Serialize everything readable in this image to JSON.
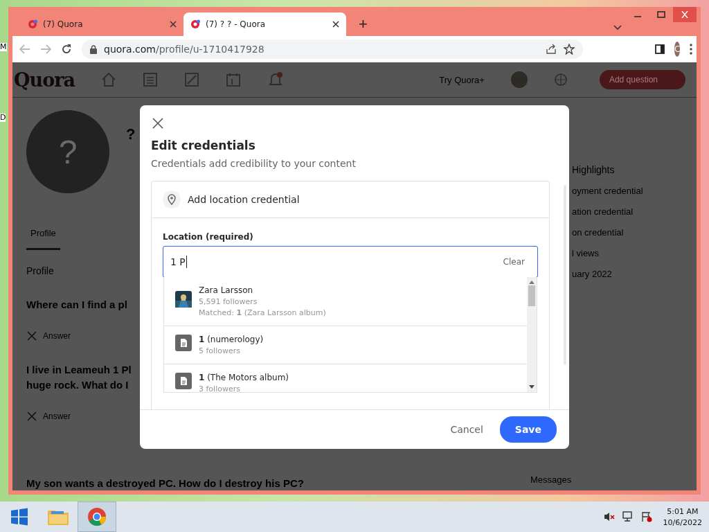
{
  "desktop": {
    "edge_labels": [
      "M",
      "D"
    ]
  },
  "browser": {
    "tabs": [
      {
        "title": "(7) Quora",
        "selected": false
      },
      {
        "title": "(7) ? ? - Quora",
        "selected": true
      }
    ],
    "new_tab": "+",
    "url_host": "quora.com",
    "url_path": "/profile/u-1710417928",
    "profile_initial": "C"
  },
  "page": {
    "logo": "Quora",
    "try_plus": "Try Quora+",
    "add_question": "Add question",
    "avatar": "?",
    "name": "?",
    "profile_tab": "Profile",
    "section": "Profile",
    "questions": [
      {
        "title": "Where can I find a pl",
        "action": "Answer"
      },
      {
        "title": "I live in Leameuh 1 Pl",
        "title_continued": "huge rock. What do I",
        "action": "Answer"
      },
      {
        "title": "My son wants a destroyed PC. How do I destroy his PC?"
      }
    ],
    "highlights_title": "Highlights",
    "highlights": [
      "oyment credential",
      "ation credential",
      "on credential",
      "l views",
      "uary 2022"
    ],
    "messages": "Messages"
  },
  "dialog": {
    "title": "Edit credentials",
    "subtitle": "Credentials add credibility to your content",
    "section": "Add location credential",
    "field_label": "Location (required)",
    "value": "1 P",
    "clear": "Clear",
    "results": [
      {
        "kind": "person",
        "title": "Zara Larsson",
        "followers": "5,591 followers",
        "matched": "Matched: **1** (Zara Larsson album)"
      },
      {
        "kind": "topic",
        "title": "**1** (numerology)",
        "followers": "5 followers"
      },
      {
        "kind": "topic",
        "title": "**1** (The Motors album)",
        "followers": "3 followers"
      }
    ],
    "cancel": "Cancel",
    "save": "Save"
  },
  "taskbar": {
    "apps": [
      {
        "kind": "folder",
        "selected": false
      },
      {
        "kind": "chrome",
        "selected": true
      }
    ],
    "time": "5:01 AM",
    "date": "10/6/2022"
  }
}
